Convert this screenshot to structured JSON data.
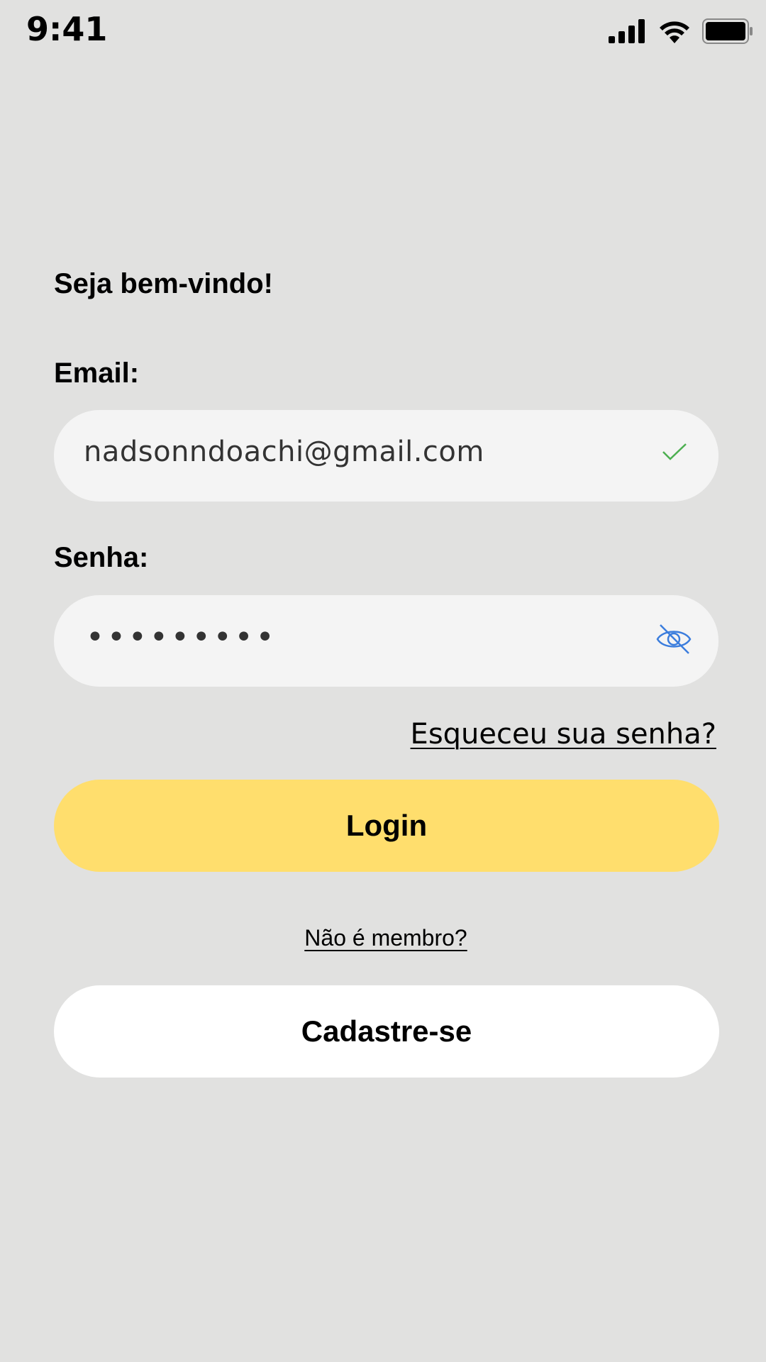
{
  "status_bar": {
    "time": "9:41",
    "icons": [
      "signal-icon",
      "wifi-icon",
      "battery-icon"
    ]
  },
  "login": {
    "welcome": "Seja bem-vindo!",
    "email_label": "Email:",
    "email_value": "nadsonndoachi@gmail.com",
    "email_valid_icon": "check-icon",
    "password_label": "Senha:",
    "password_value": "•••••••••",
    "password_toggle_icon": "eye-off-icon",
    "forgot_password": "Esqueceu sua senha?",
    "login_button": "Login",
    "not_member": "Não é membro?",
    "signup_button": "Cadastre-se"
  },
  "colors": {
    "background": "#e1e1e0",
    "input_background": "#f4f4f4",
    "login_button": "#ffde6d",
    "signup_button": "#ffffff",
    "check_green": "#4caf50",
    "eye_blue": "#3b7ddd"
  }
}
